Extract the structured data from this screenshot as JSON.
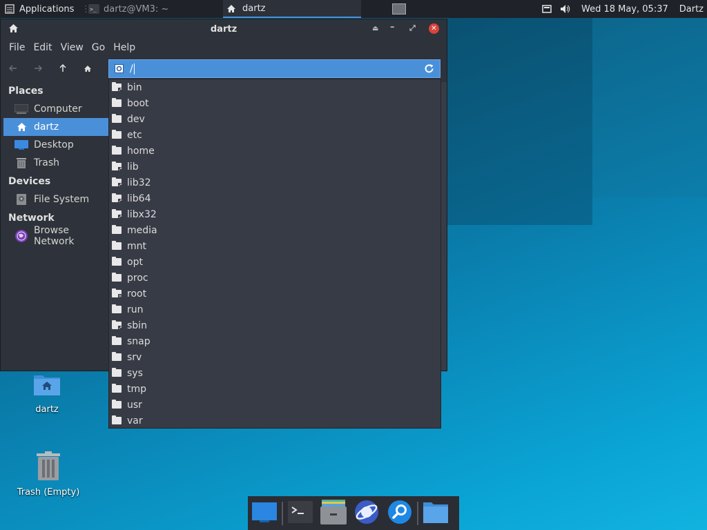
{
  "top_panel": {
    "applications_label": "Applications",
    "tasks": [
      {
        "label": "dartz@VM3: ~"
      },
      {
        "label": "dartz"
      }
    ],
    "clock": "Wed 18 May, 05:37",
    "user": "Dartz"
  },
  "window": {
    "title": "dartz",
    "menu": [
      "File",
      "Edit",
      "View",
      "Go",
      "Help"
    ],
    "location_value": "/",
    "sidebar": {
      "places_heading": "Places",
      "places": [
        "Computer",
        "dartz",
        "Desktop",
        "Trash"
      ],
      "devices_heading": "Devices",
      "devices": [
        "File System"
      ],
      "network_heading": "Network",
      "network": [
        "Browse Network"
      ]
    },
    "dropdown": [
      "bin",
      "boot",
      "dev",
      "etc",
      "home",
      "lib",
      "lib32",
      "lib64",
      "libx32",
      "media",
      "mnt",
      "opt",
      "proc",
      "root",
      "run",
      "sbin",
      "snap",
      "srv",
      "sys",
      "tmp",
      "usr",
      "var"
    ],
    "dropdown_link_items": [
      "bin",
      "lib",
      "lib32",
      "lib64",
      "libx32",
      "sbin"
    ]
  },
  "desktop": {
    "icons": [
      {
        "label": "dartz"
      },
      {
        "label": "Trash (Empty)"
      }
    ]
  },
  "colors": {
    "selection": "#4a90d9",
    "panel": "#1f2229",
    "window_bg": "#2e323b",
    "close_button": "#d9443c"
  }
}
